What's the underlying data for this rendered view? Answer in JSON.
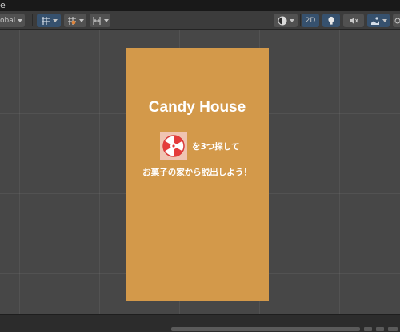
{
  "window": {
    "tab_title": "e"
  },
  "toolbar": {
    "pivot_label": "obal",
    "toggle_2d_label": "2D"
  },
  "canvas": {
    "title": "Candy House",
    "line1": "を3つ探して",
    "line2": "お菓子の家から脱出しよう！",
    "background_color": "#d3994a",
    "candy_icon": "peppermint-candy-icon"
  }
}
